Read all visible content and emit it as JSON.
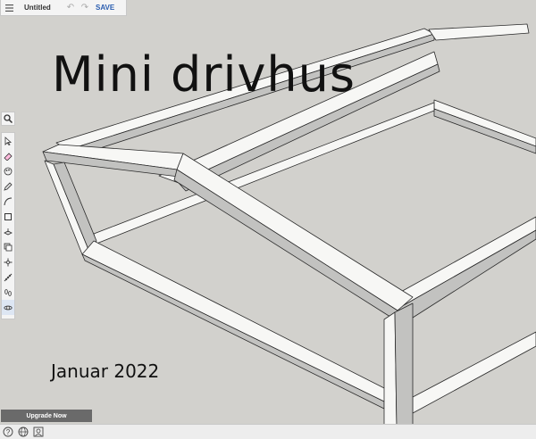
{
  "app": {
    "menu_icon": "hamburger-menu-icon",
    "document_title": "Untitled",
    "undo_icon": "undo-icon",
    "redo_icon": "redo-icon",
    "save_label": "SAVE"
  },
  "search_icon": "search-icon",
  "toolbar": {
    "tools": [
      {
        "name": "select-tool",
        "icon": "arrow-cursor-icon"
      },
      {
        "name": "eraser-tool",
        "icon": "eraser-icon"
      },
      {
        "name": "paint-bucket-tool",
        "icon": "paint-palette-icon"
      },
      {
        "name": "pencil-tool",
        "icon": "pencil-icon"
      },
      {
        "name": "arc-tool",
        "icon": "arc-icon"
      },
      {
        "name": "rectangle-tool",
        "icon": "rectangle-icon"
      },
      {
        "name": "push-pull-tool",
        "icon": "push-pull-icon"
      },
      {
        "name": "offset-tool",
        "icon": "offset-icon"
      },
      {
        "name": "move-tool",
        "icon": "move-arrows-icon"
      },
      {
        "name": "tape-measure-tool",
        "icon": "tape-measure-icon"
      },
      {
        "name": "walk-tool",
        "icon": "footprints-icon"
      },
      {
        "name": "orbit-tool",
        "icon": "orbit-icon"
      }
    ]
  },
  "scene": {
    "title": "Mini drivhus",
    "date": "Januar 2022"
  },
  "upgrade_label": "Upgrade Now",
  "statusbar": {
    "icons": [
      "help-icon",
      "globe-icon",
      "account-icon"
    ]
  },
  "colors": {
    "background": "#d2d1cd",
    "frame_face": "#f7f7f5",
    "frame_side": "#c2c2c0",
    "frame_edge": "#2a2a2a",
    "save_accent": "#2a5db0"
  }
}
